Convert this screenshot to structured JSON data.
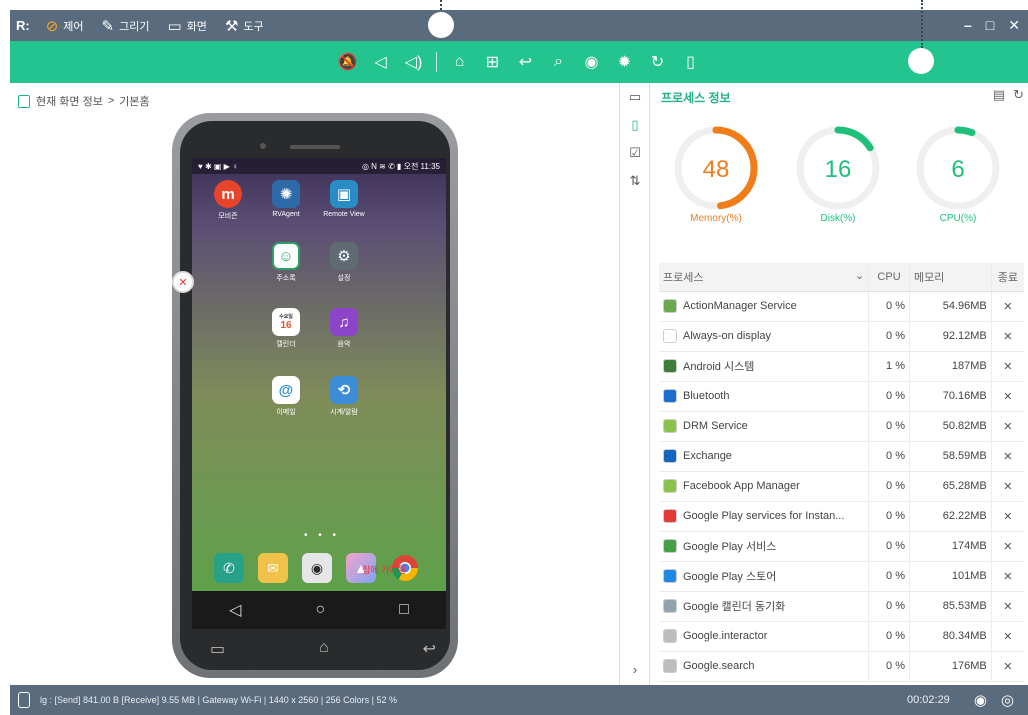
{
  "menubar": {
    "logo": "R:",
    "items": [
      {
        "label": "제어",
        "icon": "control-icon",
        "glyph": "⊘"
      },
      {
        "label": "그리기",
        "icon": "pen-icon",
        "glyph": "✎"
      },
      {
        "label": "화면",
        "icon": "screen-icon",
        "glyph": "▭"
      },
      {
        "label": "도구",
        "icon": "tools-icon",
        "glyph": "⚒"
      }
    ],
    "window_buttons": {
      "minimize": "–",
      "maximize": "□",
      "close": "✕"
    }
  },
  "toolbar": {
    "buttons": [
      {
        "name": "mute-icon",
        "glyph": "🔕"
      },
      {
        "name": "volume-down-icon",
        "glyph": "◁"
      },
      {
        "name": "volume-up-icon",
        "glyph": "◁)"
      },
      {
        "name": "home-icon",
        "glyph": "⌂"
      },
      {
        "name": "apps-icon",
        "glyph": "⊞"
      },
      {
        "name": "back-icon",
        "glyph": "↩"
      },
      {
        "name": "search-icon",
        "glyph": "⌕"
      },
      {
        "name": "camera-icon",
        "glyph": "◉"
      },
      {
        "name": "settings-icon",
        "glyph": "✹"
      },
      {
        "name": "refresh-icon",
        "glyph": "↻"
      },
      {
        "name": "device-icon",
        "glyph": "▯"
      }
    ]
  },
  "breadcrumb": {
    "current": "현재 화면 정보",
    "sep": ">",
    "page": "기본홈"
  },
  "phone": {
    "status_right": "◎ N ≋ ✆ ▮ 오전 11:35",
    "status_left": "♥ ✱ ▣ ▶ ♀",
    "apps": [
      {
        "label": "모비즌",
        "glyph": "m",
        "color": "#e8442a"
      },
      {
        "label": "RVAgent",
        "glyph": "✺",
        "color": "#2f6aa8"
      },
      {
        "label": "Remote View",
        "glyph": "▣",
        "color": "#2a8cc4"
      },
      {
        "label": "주소록",
        "glyph": "☺",
        "color": "#2e9f64"
      },
      {
        "label": "설정",
        "glyph": "⚙",
        "color": "#606a72"
      },
      {
        "label": "캘린더",
        "glyph": "16",
        "color": "#e6532d"
      },
      {
        "label": "음악",
        "glyph": "♫",
        "color": "#8c45c9"
      },
      {
        "label": "이메일",
        "glyph": "@",
        "color": "#2c8bd6"
      },
      {
        "label": "시계/알람",
        "glyph": "⟲",
        "color": "#3c8cd8"
      }
    ],
    "calendar_day": "수요일",
    "dock_overlay_text": "집에 가야될",
    "pagedots": "• • •",
    "nav": [
      "◁",
      "○",
      "□"
    ],
    "hwkeys": [
      "▭",
      "⌂",
      "↩"
    ]
  },
  "sidetabs": [
    "screen-tab-icon",
    "process-tab-icon",
    "check-tab-icon",
    "sort-tab-icon"
  ],
  "right_panel": {
    "title": "프로세스 정보",
    "gauges": [
      {
        "label": "Memory(%)",
        "value": "48",
        "fraction": 0.48,
        "color": "#f07d1a"
      },
      {
        "label": "Disk(%)",
        "value": "16",
        "fraction": 0.16,
        "color": "#1ec07a"
      },
      {
        "label": "CPU(%)",
        "value": "6",
        "fraction": 0.06,
        "color": "#1ec07a"
      }
    ],
    "table": {
      "headers": {
        "process": "프로세스",
        "cpu": "CPU",
        "memory": "메모리",
        "kill": "종료"
      },
      "rows": [
        {
          "name": "ActionManager Service",
          "cpu": "0 %",
          "mem": "54.96MB",
          "icon": "#6aa84f"
        },
        {
          "name": "Always-on display",
          "cpu": "0 %",
          "mem": "92.12MB",
          "icon": "#ffffff"
        },
        {
          "name": "Android 시스템",
          "cpu": "1 %",
          "mem": "187MB",
          "icon": "#3d7d3a"
        },
        {
          "name": "Bluetooth",
          "cpu": "0 %",
          "mem": "70.16MB",
          "icon": "#1a6fd0"
        },
        {
          "name": "DRM Service",
          "cpu": "0 %",
          "mem": "50.82MB",
          "icon": "#8bc34a"
        },
        {
          "name": "Exchange",
          "cpu": "0 %",
          "mem": "58.59MB",
          "icon": "#1565c0"
        },
        {
          "name": "Facebook App Manager",
          "cpu": "0 %",
          "mem": "65.28MB",
          "icon": "#8bc34a"
        },
        {
          "name": "Google Play services for Instan...",
          "cpu": "0 %",
          "mem": "62.22MB",
          "icon": "#e53935"
        },
        {
          "name": "Google Play 서비스",
          "cpu": "0 %",
          "mem": "174MB",
          "icon": "#43a047"
        },
        {
          "name": "Google Play 스토어",
          "cpu": "0 %",
          "mem": "101MB",
          "icon": "#1e88e5"
        },
        {
          "name": "Google 캘린더 동기화",
          "cpu": "0 %",
          "mem": "85.53MB",
          "icon": "#90a4ae"
        },
        {
          "name": "Google.interactor",
          "cpu": "0 %",
          "mem": "80.34MB",
          "icon": "#bdbdbd"
        },
        {
          "name": "Google.search",
          "cpu": "0 %",
          "mem": "176MB",
          "icon": "#bdbdbd"
        }
      ],
      "kill_glyph": "✕"
    },
    "actions": {
      "clipboard": "▤",
      "refresh": "↻"
    }
  },
  "statusbar": {
    "info": "lg : [Send] 841.00 B  [Receive] 9.55 MB | Gateway Wi-Fi | 1440 x 2560 | 256 Colors | 52 %",
    "timer": "00:02:29",
    "camera": "◉",
    "record": "◎"
  },
  "colors": {
    "header": "#5a6b7e",
    "accent": "#23c48f",
    "memory": "#f07d1a"
  }
}
